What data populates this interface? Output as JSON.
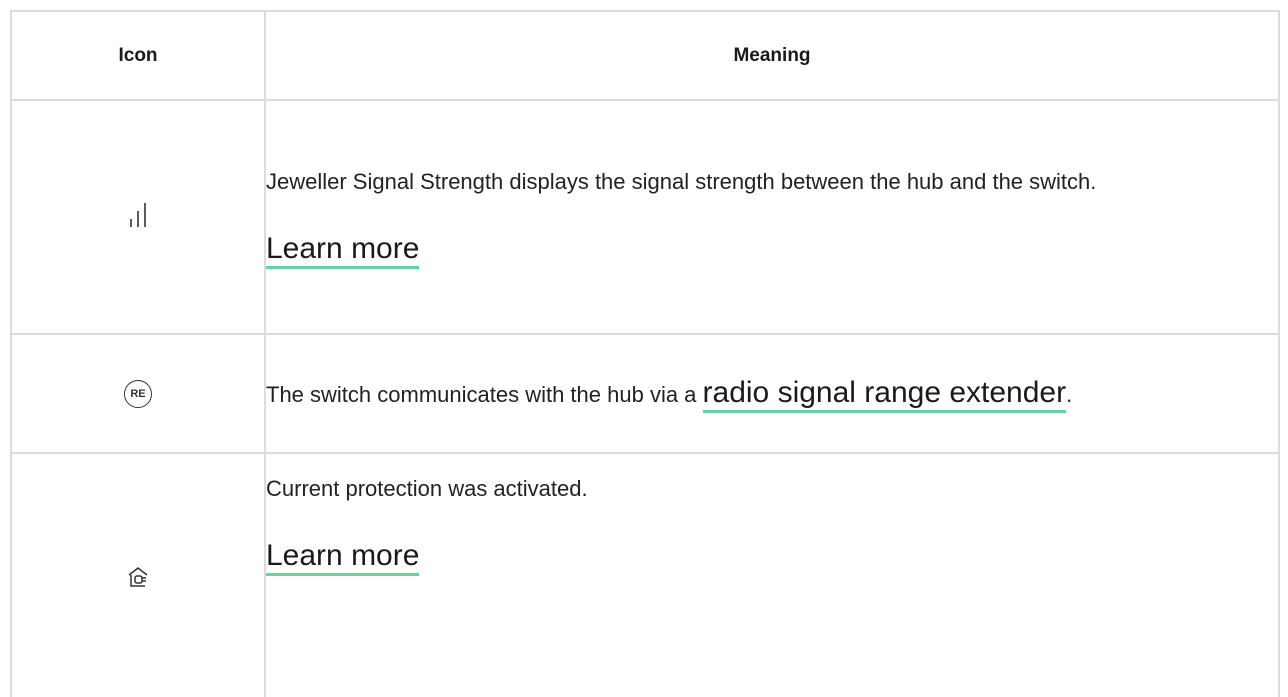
{
  "table": {
    "headers": {
      "icon": "Icon",
      "meaning": "Meaning"
    },
    "rows": [
      {
        "icon": "signal-strength-icon",
        "text": "Jeweller Signal Strength displays the signal strength between the hub and the switch.",
        "link": "Learn more"
      },
      {
        "icon": "range-extender-icon",
        "text_before": "The switch communicates with the hub via a ",
        "link": "radio signal range extender",
        "text_after": ".",
        "icon_label": "RE"
      },
      {
        "icon": "current-protection-icon",
        "text": "Current protection was activated.",
        "link": "Learn more"
      }
    ]
  },
  "colors": {
    "border": "#dcdcdc",
    "link_underline": "#5ed89f",
    "text": "#222222"
  }
}
